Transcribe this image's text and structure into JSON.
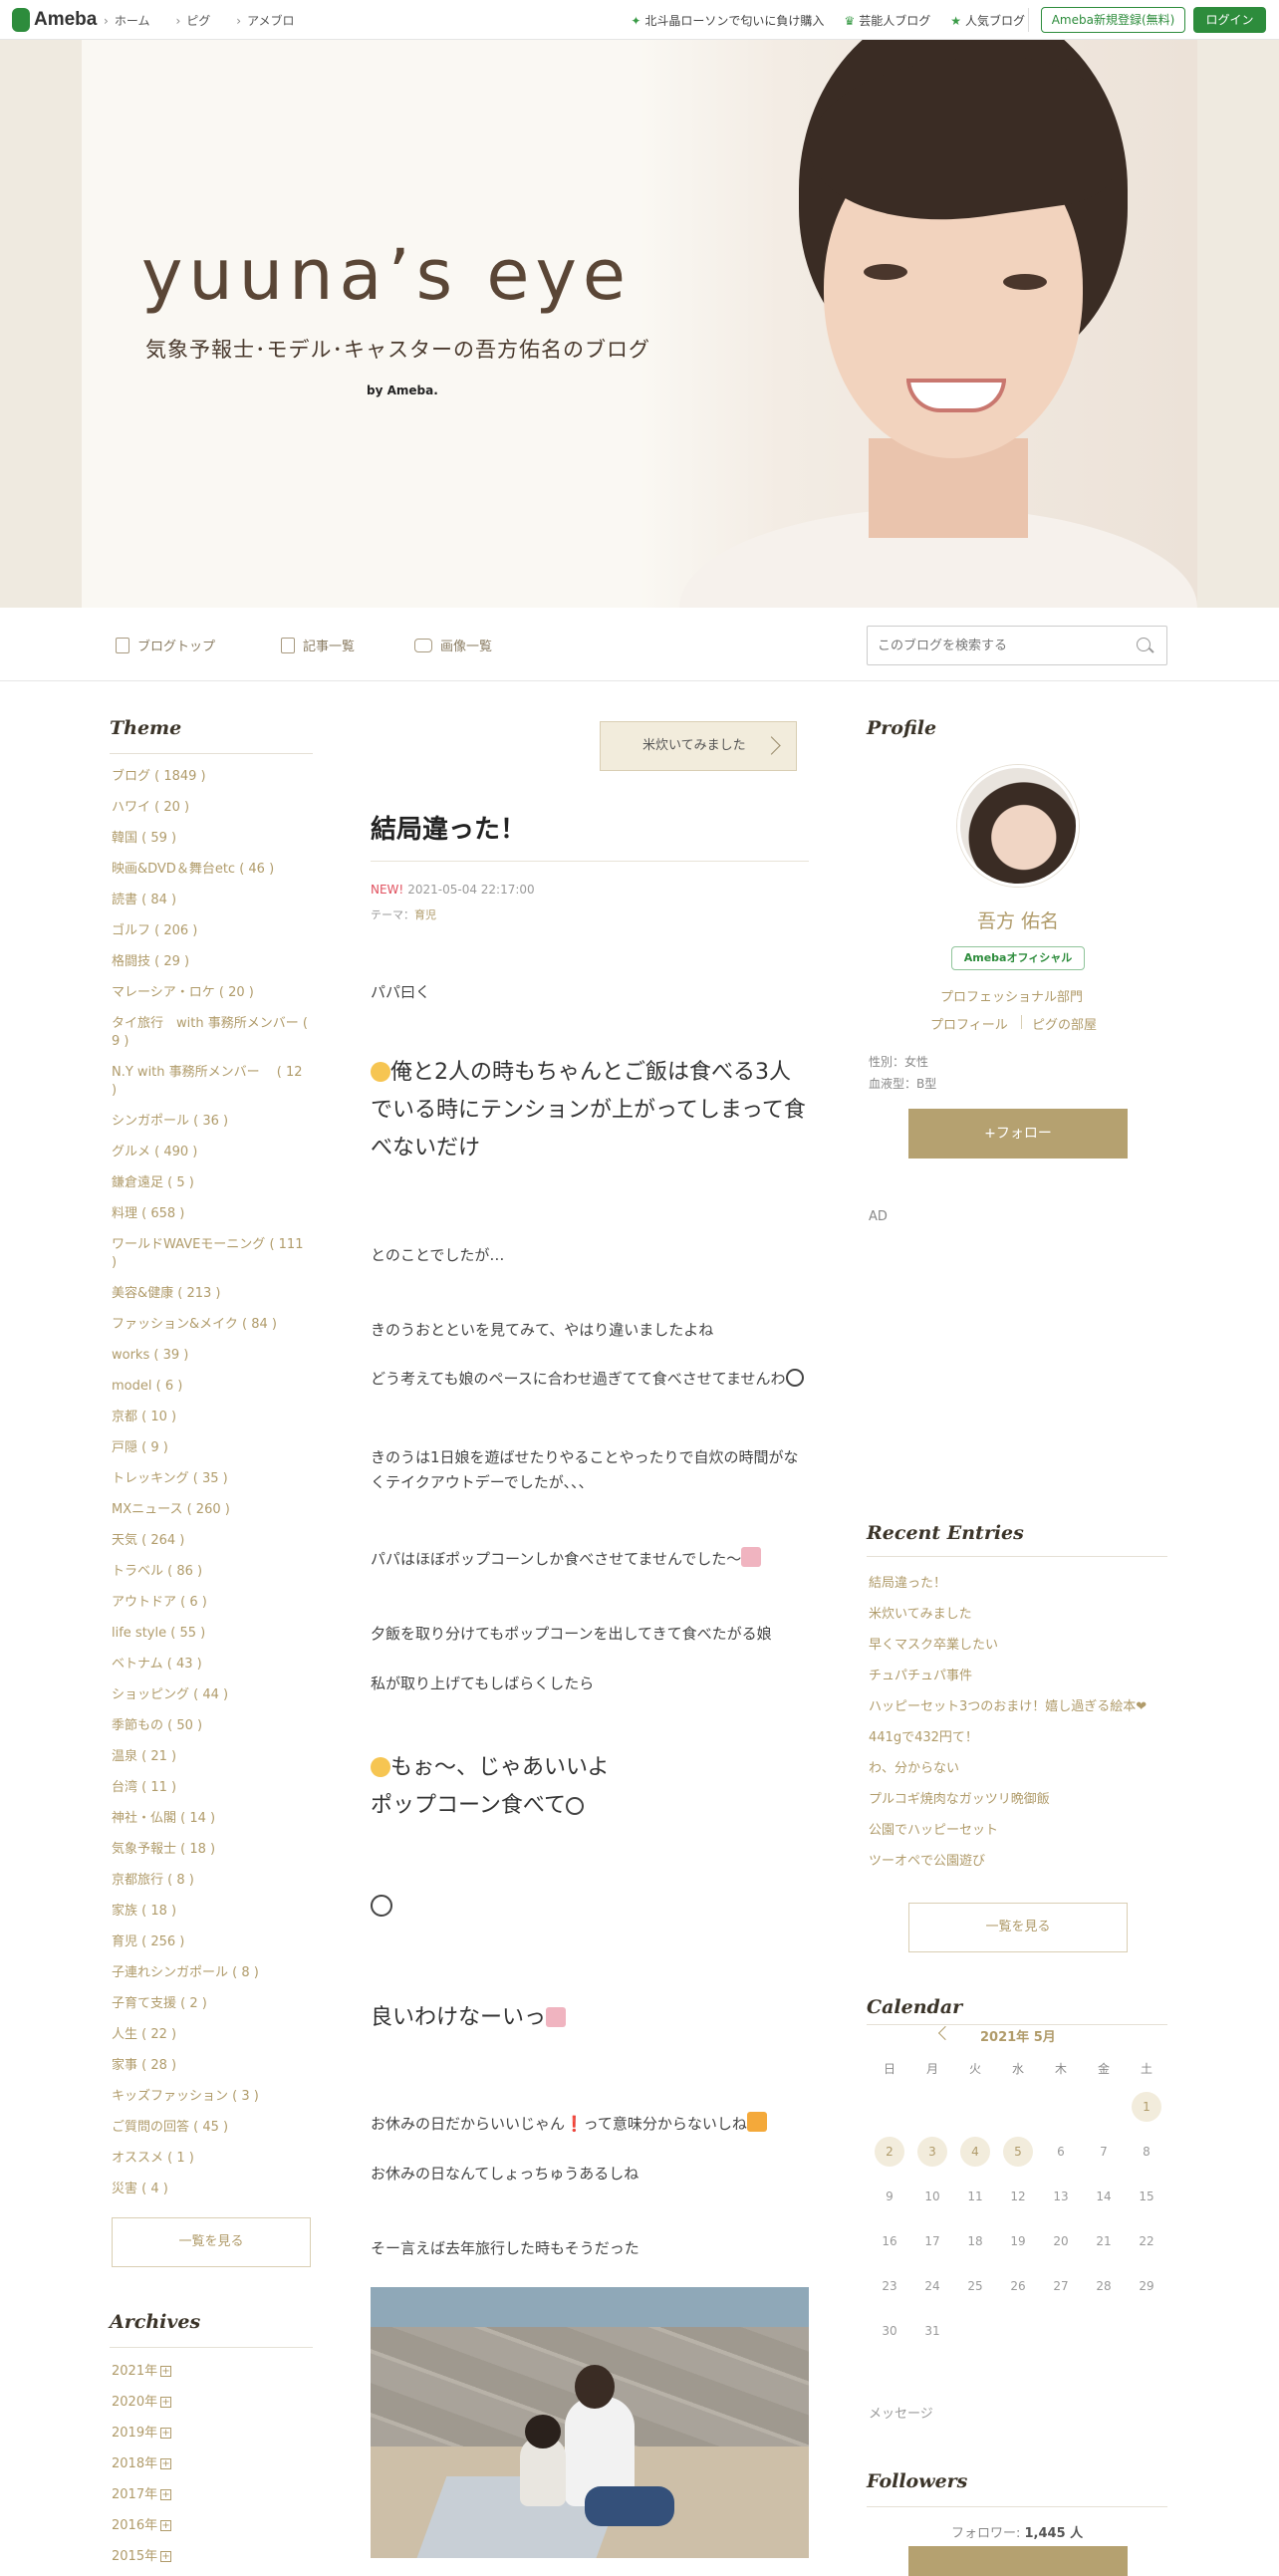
{
  "topbar": {
    "logo": "Ameba",
    "nav": [
      "ホーム",
      "ピグ",
      "アメブロ"
    ],
    "links": [
      "北斗晶ローソンで匂いに負け購入",
      "芸能人ブログ",
      "人気ブログ"
    ],
    "register_label": "Ameba新規登録(無料)",
    "login_label": "ログイン",
    "brand_color": "#2d8c3c"
  },
  "header": {
    "title": "yuuna’s eye",
    "subtitle": "気象予報士･モデル･キャスターの吾方佑名のブログ",
    "by": "by Ameba."
  },
  "blognav": {
    "items": [
      "ブログトップ",
      "記事一覧",
      "画像一覧"
    ],
    "search_placeholder": "このブログを検索する"
  },
  "theme": {
    "heading": "Theme",
    "items": [
      "ブログ ( 1849 )",
      "ハワイ ( 20 )",
      "韓国 ( 59 )",
      "映画&DVD＆舞台etc ( 46 )",
      "読書 ( 84 )",
      "ゴルフ ( 206 )",
      "格闘技 ( 29 )",
      "マレーシア・ロケ ( 20 )",
      "タイ旅行　with 事務所メンバー ( 9 )",
      "N.Y with 事務所メンバー　 ( 12 )",
      "シンガポール ( 36 )",
      "グルメ ( 490 )",
      "鎌倉遠足 ( 5 )",
      "料理 ( 658 )",
      "ワールドWAVEモーニング ( 111 )",
      "美容&健康 ( 213 )",
      "ファッション&メイク ( 84 )",
      "works ( 39 )",
      "model ( 6 )",
      "京都 ( 10 )",
      "戸隠 ( 9 )",
      "トレッキング ( 35 )",
      "MXニュース ( 260 )",
      "天気 ( 264 )",
      "トラベル ( 86 )",
      "アウトドア ( 6 )",
      "life style ( 55 )",
      "ベトナム ( 43 )",
      "ショッピング ( 44 )",
      "季節もの ( 50 )",
      "温泉 ( 21 )",
      "台湾 ( 11 )",
      "神社・仏閣 ( 14 )",
      "気象予報士 ( 18 )",
      "京都旅行 ( 8 )",
      "家族 ( 18 )",
      "育児 ( 256 )",
      "子連れシンガポール ( 8 )",
      "子育て支援 ( 2 )",
      "人生 ( 22 )",
      "家事 ( 28 )",
      "キッズファッション ( 3 )",
      "ご質問の回答 ( 45 )",
      "オススメ ( 1 )",
      "災害 ( 4 )"
    ],
    "more_label": "一覧を見る"
  },
  "archives": {
    "heading": "Archives",
    "items": [
      "2021年",
      "2020年",
      "2019年",
      "2018年",
      "2017年",
      "2016年",
      "2015年"
    ]
  },
  "entry": {
    "prev_label": "米炊いてみました",
    "title": "結局違った！",
    "new_label": "NEW!",
    "datetime": "2021-05-04 22:17:00",
    "theme_label": "テーマ：",
    "theme_value": "育児",
    "p1": "パパ曰く",
    "big1": "俺と2人の時もちゃんとご飯は食べる3人でいる時にテンションが上がってしまって食べないだけ",
    "p2": "とのことでしたが…",
    "p3": "きのうおとといを見てみて、やはり違いましたよね",
    "p4": "どう考えても娘のペースに合わせ過ぎてて食べさせてませんわ",
    "p5": "きのうは1日娘を遊ばせたりやることやったりで自炊の時間がなくテイクアウトデーでしたが、、、",
    "p6": "パパはほぼポップコーンしか食べさせてませんでした～",
    "p7": "夕飯を取り分けてもポップコーンを出してきて食べたがる娘",
    "p8": "私が取り上げてもしばらくしたら",
    "big2a": "もぉ～、じゃあいいよ",
    "big2b": "ポップコーン食べて",
    "big3": "良いわけなーいっ",
    "p9": "お休みの日だからいいじゃん❗️って意味分からないしね",
    "p10": "お休みの日なんてしょっちゅうあるしね",
    "p11": "そー言えば去年旅行した時もそうだった"
  },
  "profile": {
    "heading": "Profile",
    "name": "吾方 佑名",
    "badge": "Amebaオフィシャル",
    "category": "プロフェッショナル部門",
    "link1": "プロフィール",
    "link2": "ピグの部屋",
    "gender": "性別：女性",
    "blood": "血液型：B型",
    "follow_label": "+フォロー",
    "ad_label": "AD"
  },
  "recent": {
    "heading": "Recent Entries",
    "items": [
      "結局違った！",
      "米炊いてみました",
      "早くマスク卒業したい",
      "チュパチュパ事件",
      "ハッピーセット3つのおまけ！嬉し過ぎる絵本❤",
      "441gで432円て！",
      "わ、分からない",
      "プルコギ焼肉なガッツリ晩御飯",
      "公園でハッピーセット",
      "ツーオペで公園遊び"
    ],
    "more_label": "一覧を見る"
  },
  "calendar": {
    "heading": "Calendar",
    "title": "2021年 5月",
    "weekdays": [
      "日",
      "月",
      "火",
      "水",
      "木",
      "金",
      "土"
    ],
    "weeks": [
      [
        "",
        "",
        "",
        "",
        "",
        "",
        "1"
      ],
      [
        "2",
        "3",
        "4",
        "5",
        "6",
        "7",
        "8"
      ],
      [
        "9",
        "10",
        "11",
        "12",
        "13",
        "14",
        "15"
      ],
      [
        "16",
        "17",
        "18",
        "19",
        "20",
        "21",
        "22"
      ],
      [
        "23",
        "24",
        "25",
        "26",
        "27",
        "28",
        "29"
      ],
      [
        "30",
        "31",
        "",
        "",
        "",
        "",
        ""
      ]
    ],
    "highlighted": [
      "1",
      "2",
      "3",
      "4",
      "5"
    ]
  },
  "message_label": "メッセージ",
  "followers": {
    "heading": "Followers",
    "label": "フォロワー: ",
    "count": "1,445 人"
  }
}
